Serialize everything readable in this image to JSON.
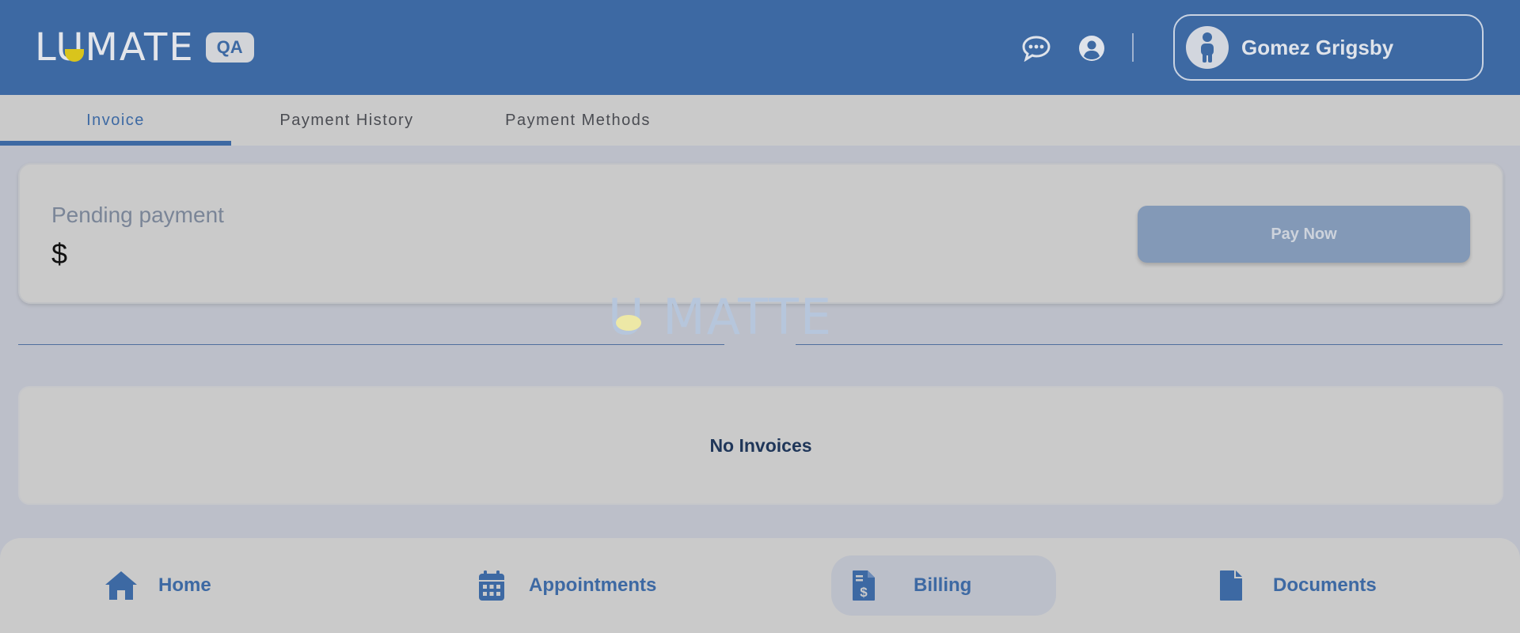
{
  "header": {
    "logo_text": "LUMATE",
    "badge": "QA",
    "chat_icon": "chat-bubble-icon",
    "account_icon": "account-circle-icon",
    "user_name": "Gomez Grigsby"
  },
  "tabs": [
    {
      "label": "Invoice",
      "active": true
    },
    {
      "label": "Payment History",
      "active": false
    },
    {
      "label": "Payment Methods",
      "active": false
    }
  ],
  "pending": {
    "title": "Pending payment",
    "amount": "$",
    "pay_button": "Pay Now"
  },
  "loading_watermark": "U MATTE",
  "invoices": {
    "empty_message": "No Invoices"
  },
  "bottom_nav": [
    {
      "label": "Home",
      "icon": "home-icon",
      "active": false
    },
    {
      "label": "Appointments",
      "icon": "calendar-icon",
      "active": false
    },
    {
      "label": "Billing",
      "icon": "invoice-dollar-icon",
      "active": true
    },
    {
      "label": "Documents",
      "icon": "document-icon",
      "active": false
    }
  ],
  "colors": {
    "brand": "#3d69a3",
    "accent_yellow": "#d9c41c",
    "overlay_background": "#bcbfc9"
  }
}
